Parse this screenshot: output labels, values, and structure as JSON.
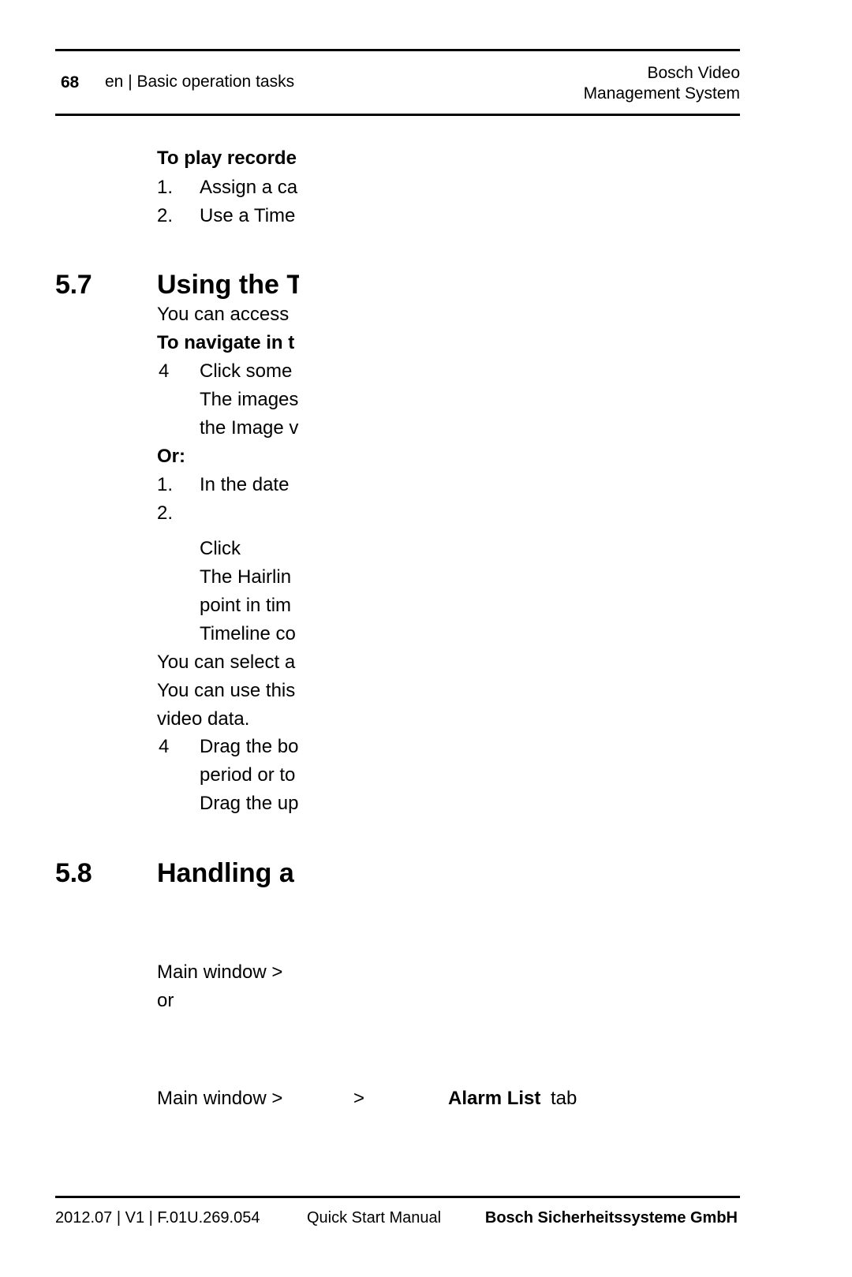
{
  "header": {
    "page_number": "68",
    "breadcrumb": "en | Basic operation tasks",
    "product_line1": "Bosch Video",
    "product_line2": "Management System"
  },
  "body": {
    "procedure_heading_1": "To play recorde",
    "step_1_marker": "1.",
    "step_1_text": "Assign a ca",
    "step_2_marker": "2.",
    "step_2_text": "Use a Time",
    "section_57_number": "5.7",
    "section_57_title": "Using the T",
    "section_57_intro": "You can access",
    "procedure_heading_2": "To navigate in t",
    "bullet_a_marker": "4",
    "bullet_a_text": "Click some",
    "bullet_a_cont_1": "The images",
    "bullet_a_cont_2": "the Image ᴠ",
    "or_label": "Or:",
    "or_step_1_marker": "1.",
    "or_step_1_text": "In the date",
    "or_step_2_marker": "2.",
    "or_step_2_line_1": "Click",
    "or_step_2_line_2": "The Hairlin",
    "or_step_2_line_3": "point in tim",
    "or_step_2_line_4": "Timeline co",
    "para_1": "You can select a",
    "para_2_line_1": "You can use this",
    "para_2_line_2": "video data.",
    "bullet_b_marker": "4",
    "bullet_b_text": "Drag the bo",
    "bullet_b_cont_1": "period or to",
    "bullet_b_cont_2": "Drag the up",
    "section_58_number": "5.8",
    "section_58_title": "Handling a",
    "path_1": "Main window >",
    "or_connector": "or",
    "path_2_prefix": "Main window >",
    "path_2_separator": ">",
    "path_2_tab_bold": "Alarm List",
    "path_2_tab_suffix": "tab"
  },
  "footer": {
    "left": "2012.07 | V1 | F.01U.269.054",
    "center": "Quick Start Manual",
    "right": "Bosch Sicherheitssysteme GmbH"
  },
  "colors": {
    "text": "#000000",
    "background": "#ffffff",
    "rule": "#000000"
  }
}
